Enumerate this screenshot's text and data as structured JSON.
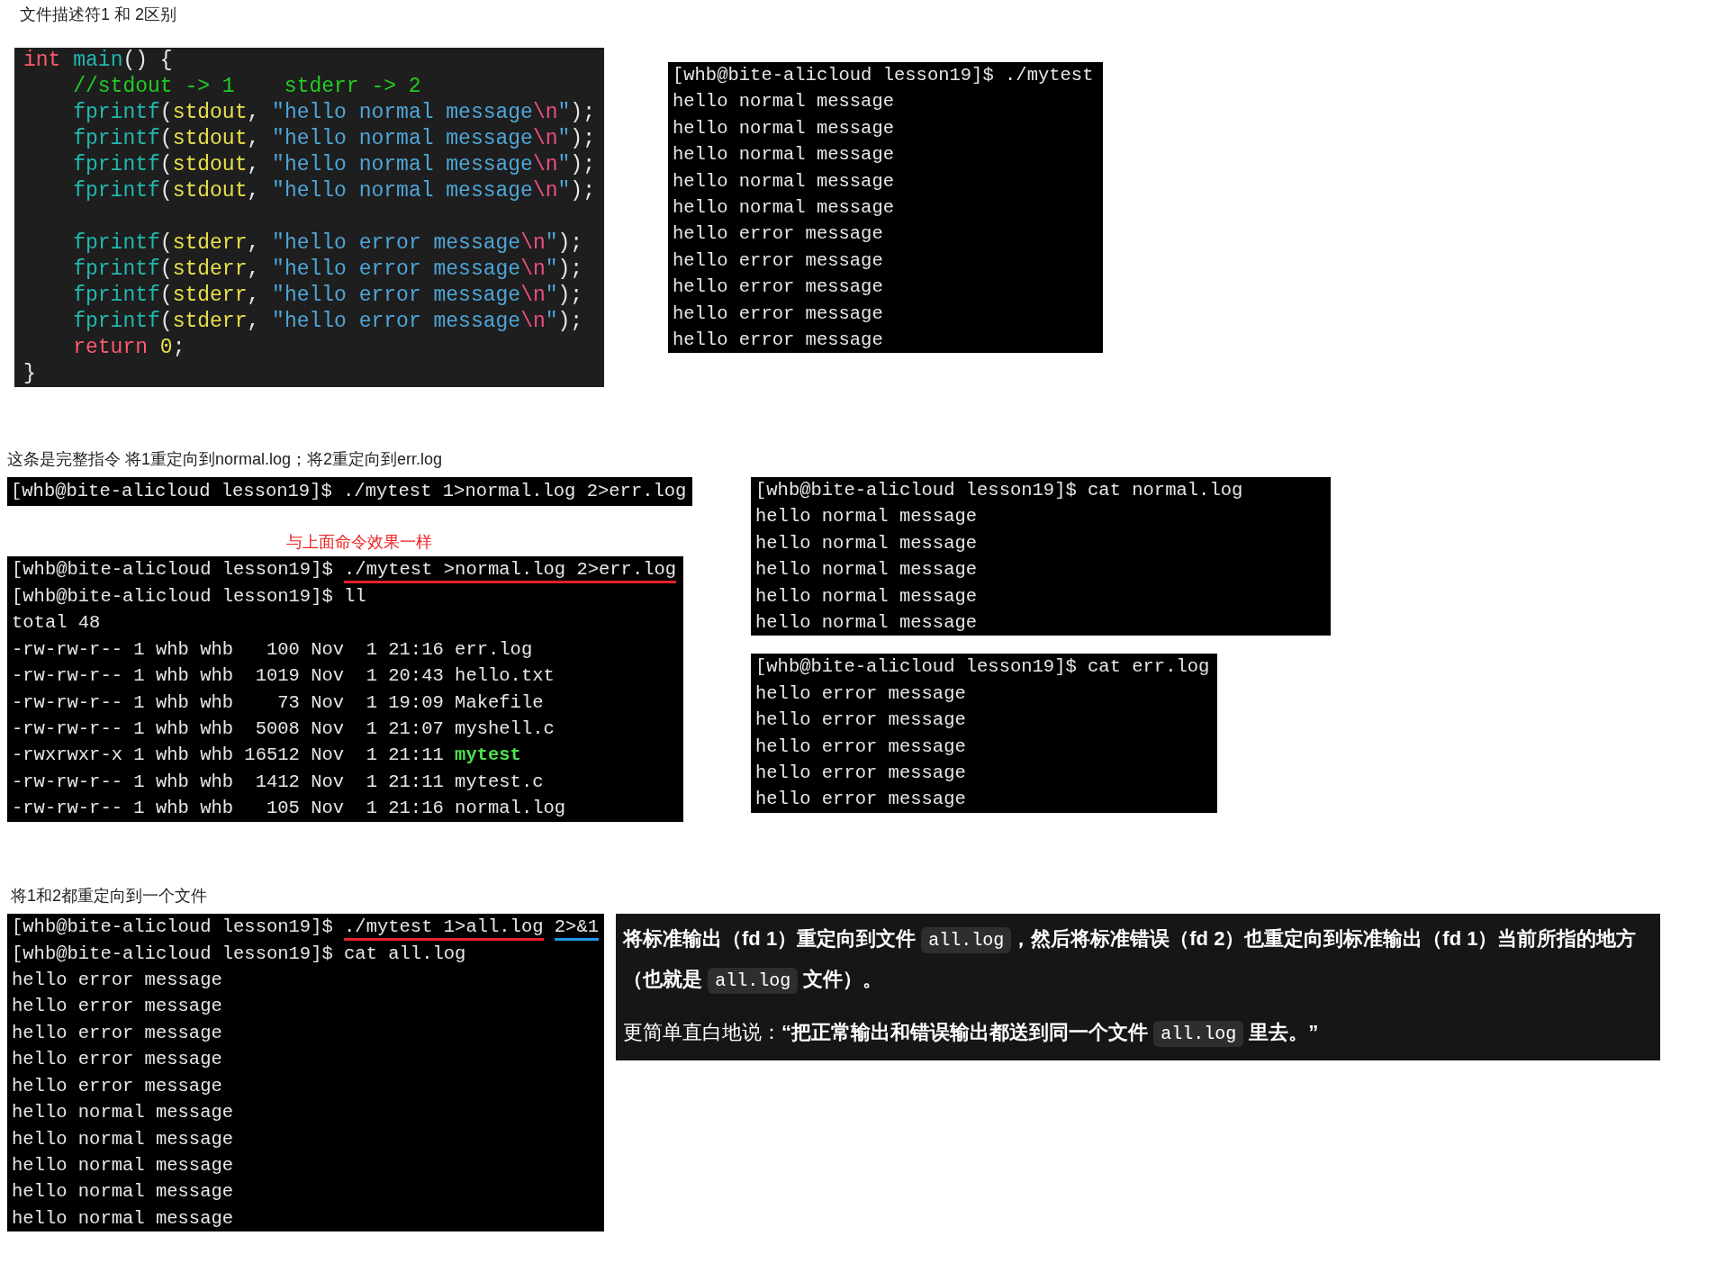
{
  "heading_1": "文件描述符1 和 2区别",
  "code_block": {
    "lines": [
      {
        "kind": "code",
        "tokens": [
          {
            "kind": "keyword",
            "text": "int"
          },
          {
            "kind": "function",
            "text": " main"
          },
          {
            "kind": "plain",
            "text": "() {"
          }
        ]
      },
      {
        "kind": "code",
        "tokens": [
          {
            "kind": "comment",
            "text": "    //stdout -> 1    stderr -> 2"
          }
        ]
      },
      {
        "kind": "code",
        "tokens": [
          {
            "kind": "function",
            "text": "    fprintf"
          },
          {
            "kind": "plain",
            "text": "("
          },
          {
            "kind": "ident",
            "text": "stdout"
          },
          {
            "kind": "plain",
            "text": ", "
          },
          {
            "kind": "string",
            "text": "\"hello normal message"
          },
          {
            "kind": "escape",
            "text": "\\n"
          },
          {
            "kind": "string",
            "text": "\""
          },
          {
            "kind": "plain",
            "text": ");"
          }
        ]
      },
      {
        "kind": "code",
        "tokens": [
          {
            "kind": "function",
            "text": "    fprintf"
          },
          {
            "kind": "plain",
            "text": "("
          },
          {
            "kind": "ident",
            "text": "stdout"
          },
          {
            "kind": "plain",
            "text": ", "
          },
          {
            "kind": "string",
            "text": "\"hello normal message"
          },
          {
            "kind": "escape",
            "text": "\\n"
          },
          {
            "kind": "string",
            "text": "\""
          },
          {
            "kind": "plain",
            "text": ");"
          }
        ]
      },
      {
        "kind": "code",
        "tokens": [
          {
            "kind": "function",
            "text": "    fprintf"
          },
          {
            "kind": "plain",
            "text": "("
          },
          {
            "kind": "ident",
            "text": "stdout"
          },
          {
            "kind": "plain",
            "text": ", "
          },
          {
            "kind": "string",
            "text": "\"hello normal message"
          },
          {
            "kind": "escape",
            "text": "\\n"
          },
          {
            "kind": "string",
            "text": "\""
          },
          {
            "kind": "plain",
            "text": ");"
          }
        ]
      },
      {
        "kind": "code",
        "tokens": [
          {
            "kind": "function",
            "text": "    fprintf"
          },
          {
            "kind": "plain",
            "text": "("
          },
          {
            "kind": "ident",
            "text": "stdout"
          },
          {
            "kind": "plain",
            "text": ", "
          },
          {
            "kind": "string",
            "text": "\"hello normal message"
          },
          {
            "kind": "escape",
            "text": "\\n"
          },
          {
            "kind": "string",
            "text": "\""
          },
          {
            "kind": "plain",
            "text": ");"
          }
        ]
      },
      {
        "kind": "blank"
      },
      {
        "kind": "code",
        "tokens": [
          {
            "kind": "function",
            "text": "    fprintf"
          },
          {
            "kind": "plain",
            "text": "("
          },
          {
            "kind": "ident",
            "text": "stderr"
          },
          {
            "kind": "plain",
            "text": ", "
          },
          {
            "kind": "string",
            "text": "\"hello error message"
          },
          {
            "kind": "escape",
            "text": "\\n"
          },
          {
            "kind": "string",
            "text": "\""
          },
          {
            "kind": "plain",
            "text": ");"
          }
        ]
      },
      {
        "kind": "code",
        "tokens": [
          {
            "kind": "function",
            "text": "    fprintf"
          },
          {
            "kind": "plain",
            "text": "("
          },
          {
            "kind": "ident",
            "text": "stderr"
          },
          {
            "kind": "plain",
            "text": ", "
          },
          {
            "kind": "string",
            "text": "\"hello error message"
          },
          {
            "kind": "escape",
            "text": "\\n"
          },
          {
            "kind": "string",
            "text": "\""
          },
          {
            "kind": "plain",
            "text": ");"
          }
        ]
      },
      {
        "kind": "code",
        "tokens": [
          {
            "kind": "function",
            "text": "    fprintf"
          },
          {
            "kind": "plain",
            "text": "("
          },
          {
            "kind": "ident",
            "text": "stderr"
          },
          {
            "kind": "plain",
            "text": ", "
          },
          {
            "kind": "string",
            "text": "\"hello error message"
          },
          {
            "kind": "escape",
            "text": "\\n"
          },
          {
            "kind": "string",
            "text": "\""
          },
          {
            "kind": "plain",
            "text": ");"
          }
        ]
      },
      {
        "kind": "code",
        "tokens": [
          {
            "kind": "function",
            "text": "    fprintf"
          },
          {
            "kind": "plain",
            "text": "("
          },
          {
            "kind": "ident",
            "text": "stderr"
          },
          {
            "kind": "plain",
            "text": ", "
          },
          {
            "kind": "string",
            "text": "\"hello error message"
          },
          {
            "kind": "escape",
            "text": "\\n"
          },
          {
            "kind": "string",
            "text": "\""
          },
          {
            "kind": "plain",
            "text": ");"
          }
        ]
      },
      {
        "kind": "code",
        "tokens": [
          {
            "kind": "keyword",
            "text": "    return"
          },
          {
            "kind": "ident",
            "text": " 0"
          },
          {
            "kind": "plain",
            "text": ";"
          }
        ]
      },
      {
        "kind": "code",
        "tokens": [
          {
            "kind": "plain",
            "text": "}"
          }
        ]
      }
    ]
  },
  "terminal_1": {
    "lines": [
      {
        "text": "[whb@bite-alicloud lesson19]$ ./mytest"
      },
      {
        "text": "hello normal message"
      },
      {
        "text": "hello normal message"
      },
      {
        "text": "hello normal message"
      },
      {
        "text": "hello normal message"
      },
      {
        "text": "hello normal message"
      },
      {
        "text": "hello error message"
      },
      {
        "text": "hello error message"
      },
      {
        "text": "hello error message"
      },
      {
        "text": "hello error message"
      },
      {
        "text": "hello error message"
      }
    ]
  },
  "heading_2": "这条是完整指令   将1重定向到normal.log；将2重定向到err.log",
  "command_bar": {
    "lines": [
      {
        "text": "[whb@bite-alicloud lesson19]$ ./mytest 1>normal.log 2>err.log"
      }
    ]
  },
  "note": "与上面命令效果一样",
  "terminal_ll": {
    "lines": [
      {
        "parts": [
          {
            "kind": "plain",
            "text": "[whb@bite-alicloud lesson19]$ "
          },
          {
            "kind": "underlined",
            "text": "./mytest >normal.log 2>err.log",
            "color": "#e8202a"
          }
        ]
      },
      {
        "text": "[whb@bite-alicloud lesson19]$ ll"
      },
      {
        "text": "total 48"
      },
      {
        "text": "-rw-rw-r-- 1 whb whb   100 Nov  1 21:16 err.log"
      },
      {
        "text": "-rw-rw-r-- 1 whb whb  1019 Nov  1 20:43 hello.txt"
      },
      {
        "text": "-rw-rw-r-- 1 whb whb    73 Nov  1 19:09 Makefile"
      },
      {
        "text": "-rw-rw-r-- 1 whb whb  5008 Nov  1 21:07 myshell.c"
      },
      {
        "parts": [
          {
            "kind": "plain",
            "text": "-rwxrwxr-x 1 whb whb 16512 Nov  1 21:11 "
          },
          {
            "kind": "exec",
            "text": "mytest"
          }
        ]
      },
      {
        "text": "-rw-rw-r-- 1 whb whb  1412 Nov  1 21:11 mytest.c"
      },
      {
        "text": "-rw-rw-r-- 1 whb whb   105 Nov  1 21:16 normal.log"
      }
    ]
  },
  "terminal_normal": {
    "lines": [
      {
        "text": "[whb@bite-alicloud lesson19]$ cat normal.log"
      },
      {
        "text": "hello normal message"
      },
      {
        "text": "hello normal message"
      },
      {
        "text": "hello normal message"
      },
      {
        "text": "hello normal message"
      },
      {
        "text": "hello normal message"
      }
    ]
  },
  "terminal_err": {
    "lines": [
      {
        "text": "[whb@bite-alicloud lesson19]$ cat err.log"
      },
      {
        "text": "hello error message"
      },
      {
        "text": "hello error message"
      },
      {
        "text": "hello error message"
      },
      {
        "text": "hello error message"
      },
      {
        "text": "hello error message"
      }
    ]
  },
  "heading_3": "将1和2都重定向到一个文件",
  "terminal_all": {
    "lines": [
      {
        "parts": [
          {
            "kind": "plain",
            "text": "[whb@bite-alicloud lesson19]$ "
          },
          {
            "kind": "underlined",
            "text": "./mytest 1>all.log",
            "color": "#e8202a"
          },
          {
            "kind": "underlined",
            "text": "2>&1",
            "color": "#1e9be8"
          }
        ]
      },
      {
        "text": "[whb@bite-alicloud lesson19]$ cat all.log"
      },
      {
        "text": "hello error message"
      },
      {
        "text": "hello error message"
      },
      {
        "text": "hello error message"
      },
      {
        "text": "hello error message"
      },
      {
        "text": "hello error message"
      },
      {
        "text": "hello normal message"
      },
      {
        "text": "hello normal message"
      },
      {
        "text": "hello normal message"
      },
      {
        "text": "hello normal message"
      },
      {
        "text": "hello normal message"
      }
    ]
  },
  "explanation": {
    "paragraphs": [
      {
        "segments": [
          {
            "kind": "bold",
            "text": "将标准输出（fd 1）重定向到文件 "
          },
          {
            "kind": "code",
            "text": "all.log"
          },
          {
            "kind": "bold",
            "text": "，然后将标准错误（fd 2）也重定向到标准输出（fd 1）当前所指的地方（也就是 "
          },
          {
            "kind": "code",
            "text": "all.log"
          },
          {
            "kind": "bold",
            "text": " 文件）。"
          }
        ]
      },
      {
        "segments": [
          {
            "kind": "plain",
            "text": "更简单直白地说："
          },
          {
            "kind": "bold",
            "text": "“把正常输出和错误输出都送到同一个文件 "
          },
          {
            "kind": "code",
            "text": "all.log"
          },
          {
            "kind": "bold",
            "text": " 里去。”"
          }
        ]
      }
    ]
  }
}
